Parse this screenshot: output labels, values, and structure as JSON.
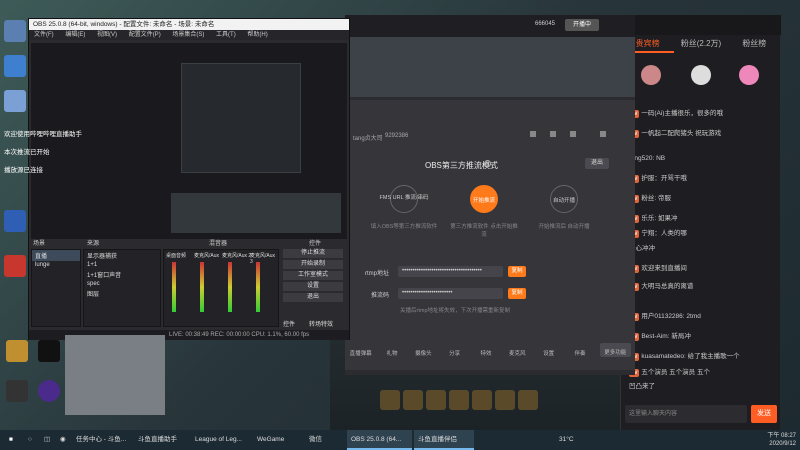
{
  "desktop": {
    "icons": [
      "Apex",
      "EPIC",
      "GTA"
    ]
  },
  "overlay_lines": [
    "欢迎使用哔哩哔哩直播助手",
    "本次推流已开始",
    "播放源已连接"
  ],
  "obs": {
    "title": "OBS 25.0.8 (64-bit, windows) - 配置文件: 未命名 - 场景: 未命名",
    "menu": [
      "文件(F)",
      "编辑(E)",
      "视图(V)",
      "配置文件(P)",
      "场景集合(S)",
      "工具(T)",
      "帮助(H)"
    ],
    "docks": {
      "scenes_title": "场景",
      "sources_title": "来源",
      "mixer_title": "混音器",
      "controls_title": "控件"
    },
    "scenes": [
      "直播",
      "lunge"
    ],
    "sources": [
      "显示器捕获",
      "1+1",
      "1+1窗口声音",
      "spec",
      "图层"
    ],
    "mixer_channels": [
      "桌面音频",
      "麦克风/Aux",
      "麦克风/Aux 2",
      "麦克风/Aux 3"
    ],
    "controls": [
      "停止推流",
      "开始录制",
      "工作室模式",
      "设置",
      "退出"
    ],
    "tabs": [
      "控件",
      "转场特效"
    ],
    "status": "LIVE: 00:38:49   REC: 00:00:00   CPU: 1.1%, 60.00 fps"
  },
  "douyu": {
    "top_stats": "666045",
    "top_button": "开播中",
    "room_id": "9292386",
    "streamer": "tang贞大司",
    "mode_title": "OBS第三方推流模式",
    "help_icon": "?",
    "exit": "退出",
    "steps": [
      {
        "label": "FMS URL\n推流/串码",
        "caption": "填入OBS等第三方推流软件"
      },
      {
        "label": "开始推流",
        "caption": "第三方推流软件\n点击开始推流"
      },
      {
        "label": "自动开播",
        "caption": "开始推流后\n自动开播"
      }
    ],
    "rtmp_label": "rtmp地址",
    "rtmp_value": "••••••••••••••••••••••••••••••••••••••",
    "code_label": "推流码",
    "code_value": "••••••••••••••••••••••••",
    "copy": "复制",
    "note": "关播后rtmp地址将失效，下次开播需重新复制",
    "tools": [
      "直播弹幕",
      "礼物",
      "摄像头",
      "分享",
      "特效",
      "麦克风",
      "设置",
      "伴奏"
    ],
    "more": "更多功能"
  },
  "chat": {
    "tabs": [
      "贵宾榜",
      "粉丝(2.2万)",
      "粉丝榜"
    ],
    "messages": [
      "一码(Ai)主播很乐，很多的哦",
      "一帆起二配爬猪头 祝玩游戏",
      "tang520: NB",
      "护服：开骂干哦",
      "粉丝: 帝服",
      "乐乐: 如果冲",
      "宁翔：人类的哪",
      "开心冲冲",
      "欢迎来到直播间",
      "大明马总真的离谱",
      "用户01132286: 2tmd",
      "Best-Aim: 新局冲",
      "kuasamatedeo: 给了我主播歌一个",
      "五个演员 五个演员 五个",
      "凹凸来了"
    ],
    "send_button": "发送",
    "input_placeholder": "这里输入聊天内容"
  },
  "taskbar": {
    "items": [
      "任务中心 - 斗鱼...",
      "斗鱼直播助手",
      "League of Leg...",
      "WeGame",
      "微信",
      "OBS 25.0.8 (64...",
      "斗鱼直播伴侣"
    ],
    "temp": "31°C",
    "time": "下午 08:27",
    "date": "2020/9/12"
  }
}
